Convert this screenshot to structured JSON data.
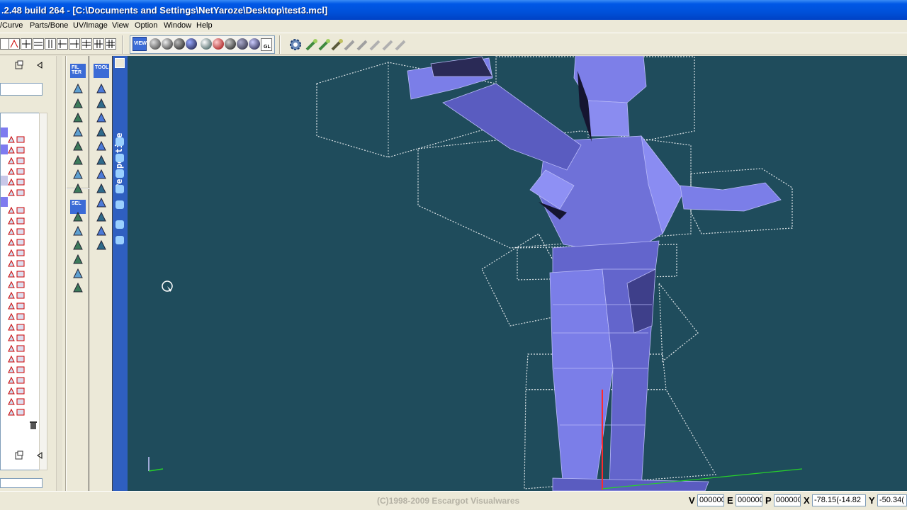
{
  "window": {
    "title": ".2.48 build 264 - [C:\\Documents and Settings\\NetYaroze\\Desktop\\test3.mcl]"
  },
  "menu": [
    {
      "label": "/Curve"
    },
    {
      "label": "Parts/Bone"
    },
    {
      "label": "UV/Image"
    },
    {
      "label": "View"
    },
    {
      "label": "Option"
    },
    {
      "label": "Window"
    },
    {
      "label": "Help"
    }
  ],
  "viewport": {
    "view_label": "Perspective",
    "background_color": "#1f4c5c",
    "mesh_color": "#7c7fe6",
    "wire_color": "#ffffff"
  },
  "tool_headers": {
    "filter": "FIL TER",
    "tool": "TOOL",
    "select": "SEL",
    "view": "VIEW",
    "gl": "GL"
  },
  "status": {
    "copyright": "(C)1998-2009 Escargot Visualwares",
    "v_label": "V",
    "v_value": "000000",
    "e_label": "E",
    "e_value": "000000",
    "p_label": "P",
    "p_value": "000000",
    "x_label": "X",
    "x_value": "-78.15(-14.82",
    "y_label": "Y",
    "y_value": "-50.34("
  },
  "icons": [
    "grid-icon",
    "render-sphere-icon",
    "gear-icon",
    "bone-icon",
    "lock-icon",
    "trash-icon",
    "pin-icon",
    "arrow-left-icon",
    "cursor-icon"
  ]
}
